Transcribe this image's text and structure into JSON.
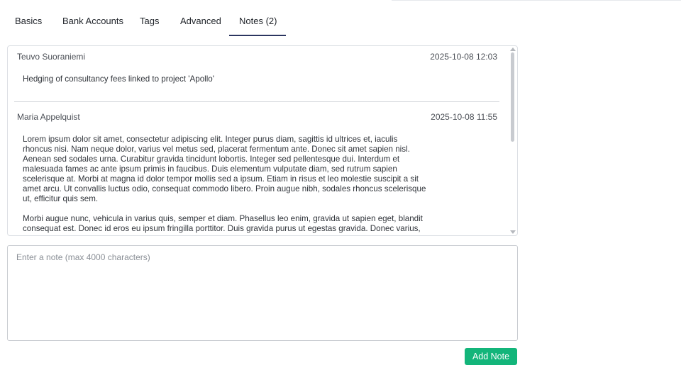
{
  "tabs": [
    {
      "label": "Basics"
    },
    {
      "label": "Bank Accounts"
    },
    {
      "label": "Tags"
    },
    {
      "label": "Advanced"
    },
    {
      "label": "Notes (2)",
      "active": true
    }
  ],
  "notes": [
    {
      "author": "Teuvo Suoraniemi",
      "date": "2025-10-08 12:03",
      "paragraphs": [
        "Hedging of consultancy fees linked to project 'Apollo'"
      ]
    },
    {
      "author": "Maria Appelquist",
      "date": "2025-10-08 11:55",
      "paragraphs": [
        "Lorem ipsum dolor sit amet, consectetur adipiscing elit. Integer purus diam, sagittis id ultrices et, iaculis rhoncus nisi. Nam neque dolor, varius vel metus sed, placerat fermentum ante. Donec sit amet sapien nisl. Aenean sed sodales urna. Curabitur gravida tincidunt lobortis. Integer sed pellentesque dui. Interdum et malesuada fames ac ante ipsum primis in faucibus. Duis elementum vulputate diam, sed rutrum sapien scelerisque at. Morbi at magna id dolor tempor mollis sed a ipsum. Etiam in risus et leo molestie suscipit a sit amet arcu. Ut convallis luctus odio, consequat commodo libero. Proin augue nibh, sodales rhoncus scelerisque ut, efficitur quis sem.",
        "Morbi augue nunc, vehicula in varius quis, semper et diam. Phasellus leo enim, gravida ut sapien eget, blandit consequat est. Donec id eros eu ipsum fringilla porttitor. Duis gravida purus ut egestas gravida. Donec varius,"
      ]
    }
  ],
  "input": {
    "placeholder": "Enter a note (max 4000 characters)",
    "value": ""
  },
  "actions": {
    "add_note_label": "Add Note"
  },
  "colors": {
    "accent_button": "#13b57a",
    "active_tab_underline": "#2b3560"
  }
}
